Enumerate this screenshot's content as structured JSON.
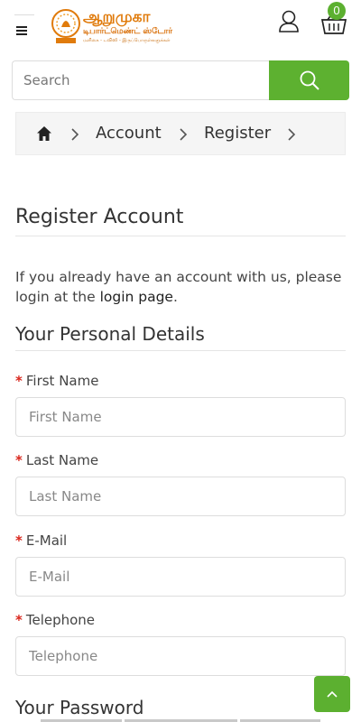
{
  "header": {
    "logo": {
      "title": "ஆறுமுகா",
      "subtitle": "டிபார்ட்மெண்ட் ஸ்டோர்",
      "tagline": "மளிகை - டவிஸி - இருப்பொருள்களுக்கள்"
    },
    "menu_icon": "hamburger-icon",
    "user_icon": "user-icon",
    "cart_icon": "basket-icon",
    "cart_count": "0",
    "accent_color": "#5cb030"
  },
  "search": {
    "placeholder": "Search",
    "button_icon": "search-icon"
  },
  "breadcrumb": {
    "home_icon": "home-icon",
    "items": [
      "Account",
      "Register"
    ]
  },
  "page": {
    "title": "Register Account",
    "intro_text": "If you already have an account with us, please login at the ",
    "intro_link": "login page",
    "intro_end": "."
  },
  "personal": {
    "title": "Your Personal Details",
    "fields": [
      {
        "label": "First Name",
        "placeholder": "First Name",
        "required": "*"
      },
      {
        "label": "Last Name",
        "placeholder": "Last Name",
        "required": "*"
      },
      {
        "label": "E-Mail",
        "placeholder": "E-Mail",
        "required": "*"
      },
      {
        "label": "Telephone",
        "placeholder": "Telephone",
        "required": "*"
      }
    ]
  },
  "password": {
    "title": "Your Password"
  },
  "scroll_top_icon": "chevron-up-icon"
}
